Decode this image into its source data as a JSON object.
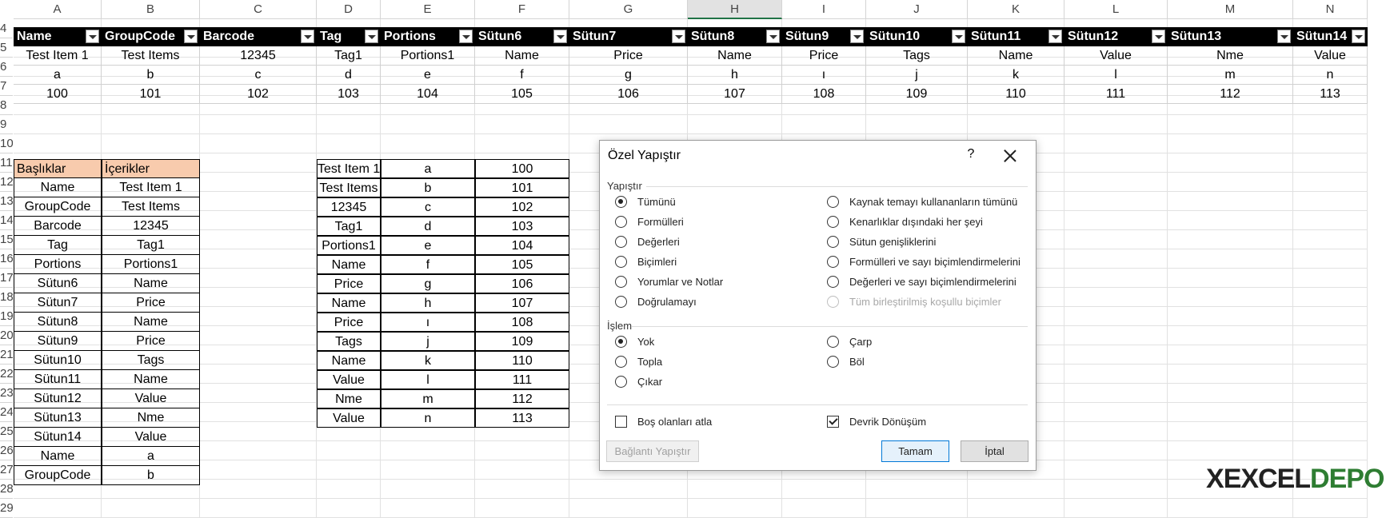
{
  "column_headers": [
    "A",
    "B",
    "C",
    "D",
    "E",
    "F",
    "G",
    "H",
    "I",
    "J",
    "K",
    "L",
    "M",
    "N"
  ],
  "selected_column": "H",
  "row_headers": [
    "4",
    "5",
    "6",
    "7",
    "8",
    "9",
    "10",
    "11",
    "12",
    "13",
    "14",
    "15",
    "16",
    "17",
    "18",
    "19",
    "20",
    "21",
    "22",
    "23",
    "24",
    "25",
    "26",
    "27",
    "28",
    "29"
  ],
  "top_table": {
    "headers": [
      "Name",
      "GroupCode",
      "Barcode",
      "Tag",
      "Portions",
      "Sütun6",
      "Sütun7",
      "Sütun8",
      "Sütun9",
      "Sütun10",
      "Sütun11",
      "Sütun12",
      "Sütun13",
      "Sütun14"
    ],
    "rows": [
      [
        "Test Item 1",
        "Test Items",
        "12345",
        "Tag1",
        "Portions1",
        "Name",
        "Price",
        "Name",
        "Price",
        "Tags",
        "Name",
        "Value",
        "Nme",
        "Value"
      ],
      [
        "a",
        "b",
        "c",
        "d",
        "e",
        "f",
        "g",
        "h",
        "ı",
        "j",
        "k",
        "l",
        "m",
        "n"
      ],
      [
        "100",
        "101",
        "102",
        "103",
        "104",
        "105",
        "106",
        "107",
        "108",
        "109",
        "110",
        "111",
        "112",
        "113"
      ]
    ]
  },
  "left_table": {
    "headers": [
      "Başlıklar",
      "İçerikler"
    ],
    "rows": [
      [
        "Name",
        "Test Item 1"
      ],
      [
        "GroupCode",
        "Test Items"
      ],
      [
        "Barcode",
        "12345"
      ],
      [
        "Tag",
        "Tag1"
      ],
      [
        "Portions",
        "Portions1"
      ],
      [
        "Sütun6",
        "Name"
      ],
      [
        "Sütun7",
        "Price"
      ],
      [
        "Sütun8",
        "Name"
      ],
      [
        "Sütun9",
        "Price"
      ],
      [
        "Sütun10",
        "Tags"
      ],
      [
        "Sütun11",
        "Name"
      ],
      [
        "Sütun12",
        "Value"
      ],
      [
        "Sütun13",
        "Nme"
      ],
      [
        "Sütun14",
        "Value"
      ],
      [
        "Name",
        "a"
      ],
      [
        "GroupCode",
        "b"
      ]
    ]
  },
  "transposed_table": {
    "rows": [
      [
        "Test Item 1",
        "a",
        "100"
      ],
      [
        "Test Items",
        "b",
        "101"
      ],
      [
        "12345",
        "c",
        "102"
      ],
      [
        "Tag1",
        "d",
        "103"
      ],
      [
        "Portions1",
        "e",
        "104"
      ],
      [
        "Name",
        "f",
        "105"
      ],
      [
        "Price",
        "g",
        "106"
      ],
      [
        "Name",
        "h",
        "107"
      ],
      [
        "Price",
        "ı",
        "108"
      ],
      [
        "Tags",
        "j",
        "109"
      ],
      [
        "Name",
        "k",
        "110"
      ],
      [
        "Value",
        "l",
        "111"
      ],
      [
        "Nme",
        "m",
        "112"
      ],
      [
        "Value",
        "n",
        "113"
      ]
    ]
  },
  "dialog": {
    "title": "Özel Yapıştır",
    "help": "?",
    "paste_group_label": "Yapıştır",
    "paste_options": [
      {
        "label": "Tümünü",
        "selected": true
      },
      {
        "label": "Formülleri",
        "selected": false
      },
      {
        "label": "Değerleri",
        "selected": false
      },
      {
        "label": "Biçimleri",
        "selected": false
      },
      {
        "label": "Yorumlar ve Notlar",
        "selected": false
      },
      {
        "label": "Doğrulamayı",
        "selected": false
      },
      {
        "label": "Kaynak temayı kullananların tümünü",
        "selected": false
      },
      {
        "label": "Kenarlıklar dışındaki her şeyi",
        "selected": false
      },
      {
        "label": "Sütun genişliklerini",
        "selected": false
      },
      {
        "label": "Formülleri ve sayı biçimlendirmelerini",
        "selected": false
      },
      {
        "label": "Değerleri ve sayı biçimlendirmelerini",
        "selected": false
      },
      {
        "label": "Tüm birleştirilmiş koşullu biçimler",
        "selected": false,
        "disabled": true
      }
    ],
    "operation_group_label": "İşlem",
    "operation_options": [
      {
        "label": "Yok",
        "selected": true
      },
      {
        "label": "Topla",
        "selected": false
      },
      {
        "label": "Çıkar",
        "selected": false
      },
      {
        "label": "Çarp",
        "selected": false
      },
      {
        "label": "Böl",
        "selected": false
      }
    ],
    "skip_blanks_label": "Boş olanları atla",
    "skip_blanks_checked": false,
    "transpose_label": "Devrik Dönüşüm",
    "transpose_checked": true,
    "paste_link_label": "Bağlantı Yapıştır",
    "ok_label": "Tamam",
    "cancel_label": "İptal"
  },
  "watermark": {
    "text_left": "X",
    "text_mid": "EXCEL",
    "text_right": "DEPO"
  }
}
